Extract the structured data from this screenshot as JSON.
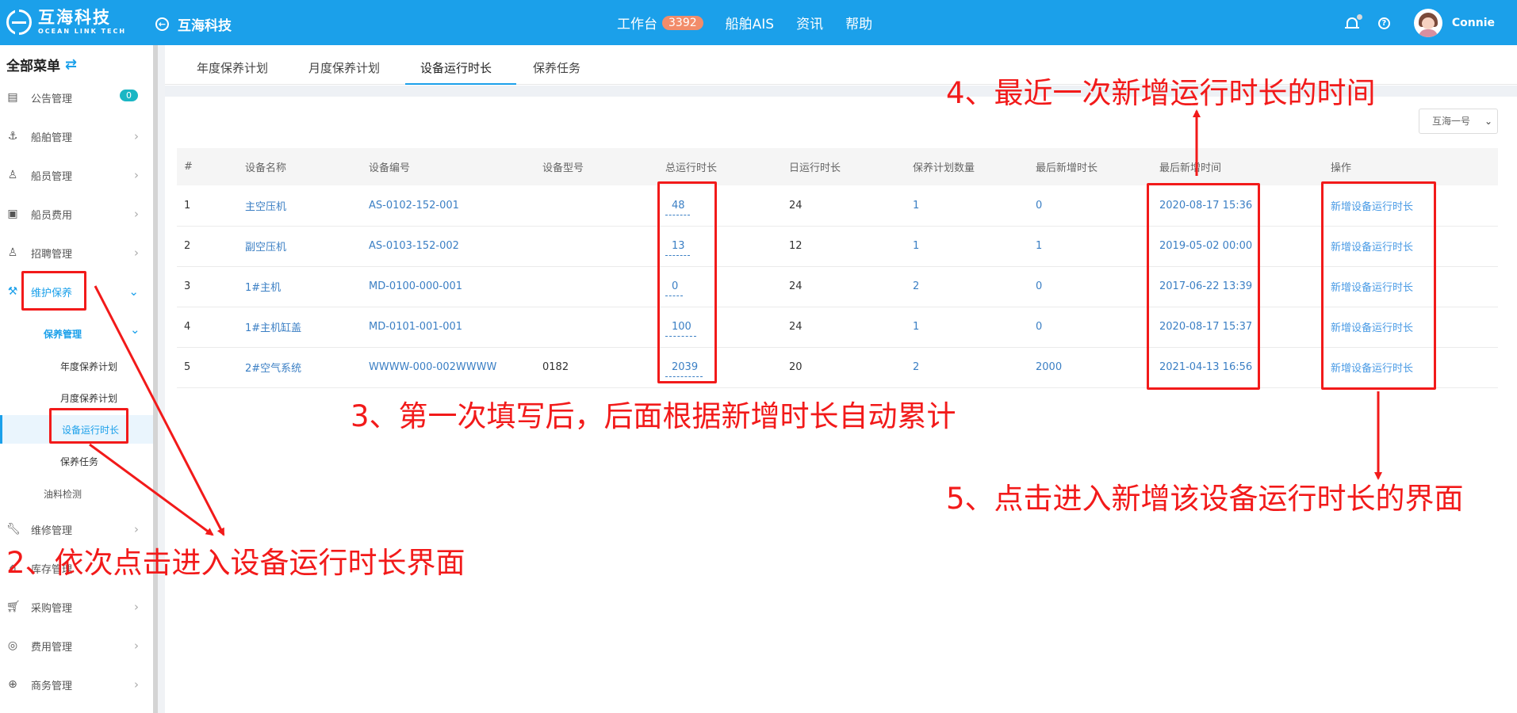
{
  "header": {
    "logo_cn": "互海科技",
    "logo_en": "OCEAN LINK TECH",
    "back_title": "互海科技",
    "nav": [
      {
        "label": "工作台",
        "badge": "3392"
      },
      {
        "label": "船舶AIS"
      },
      {
        "label": "资讯"
      },
      {
        "label": "帮助"
      }
    ],
    "username": "Connie"
  },
  "sidebar": {
    "title": "全部菜单",
    "items": [
      {
        "label": "公告管理",
        "badge": "0"
      },
      {
        "label": "船舶管理"
      },
      {
        "label": "船员管理"
      },
      {
        "label": "船员费用"
      },
      {
        "label": "招聘管理"
      },
      {
        "label": "维护保养"
      },
      {
        "label": "维修管理"
      },
      {
        "label": "库存管理"
      },
      {
        "label": "采购管理"
      },
      {
        "label": "费用管理"
      },
      {
        "label": "商务管理"
      }
    ],
    "sub_group": "保养管理",
    "sub_items": [
      "年度保养计划",
      "月度保养计划",
      "设备运行时长",
      "保养任务"
    ],
    "other_sub": "油料检测"
  },
  "tabs": [
    "年度保养计划",
    "月度保养计划",
    "设备运行时长",
    "保养任务"
  ],
  "ship_select": "互海一号",
  "table": {
    "columns": [
      "#",
      "设备名称",
      "设备编号",
      "设备型号",
      "总运行时长",
      "日运行时长",
      "保养计划数量",
      "最后新增时长",
      "最后新增时间",
      "操作"
    ],
    "rows": [
      {
        "no": "1",
        "name": "主空压机",
        "code": "AS-0102-152-001",
        "model": "",
        "total": "48",
        "daily": "24",
        "plans": "1",
        "last_add": "0",
        "last_time": "2020-08-17 15:36",
        "action": "新增设备运行时长"
      },
      {
        "no": "2",
        "name": "副空压机",
        "code": "AS-0103-152-002",
        "model": "",
        "total": "13",
        "daily": "12",
        "plans": "1",
        "last_add": "1",
        "last_time": "2019-05-02 00:00",
        "action": "新增设备运行时长"
      },
      {
        "no": "3",
        "name": "1#主机",
        "code": "MD-0100-000-001",
        "model": "",
        "total": "0",
        "daily": "24",
        "plans": "2",
        "last_add": "0",
        "last_time": "2017-06-22 13:39",
        "action": "新增设备运行时长"
      },
      {
        "no": "4",
        "name": "1#主机缸盖",
        "code": "MD-0101-001-001",
        "model": "",
        "total": "100",
        "daily": "24",
        "plans": "1",
        "last_add": "0",
        "last_time": "2020-08-17 15:37",
        "action": "新增设备运行时长"
      },
      {
        "no": "5",
        "name": "2#空气系统",
        "code": "WWWW-000-002WWWW",
        "model": "0182",
        "total": "2039",
        "daily": "20",
        "plans": "2",
        "last_add": "2000",
        "last_time": "2021-04-13 16:56",
        "action": "新增设备运行时长"
      }
    ]
  },
  "annotations": {
    "note2": "2、依次点击进入设备运行时长界面",
    "note3": "3、第一次填写后，后面根据新增时长自动累计",
    "note4": "4、最近一次新增运行时长的时间",
    "note5": "5、点击进入新增该设备运行时长的界面",
    "color": "#f21a1a"
  },
  "colors": {
    "primary": "#1ba0ea",
    "link": "#3b7fc4",
    "badge": "#f28c6a"
  }
}
